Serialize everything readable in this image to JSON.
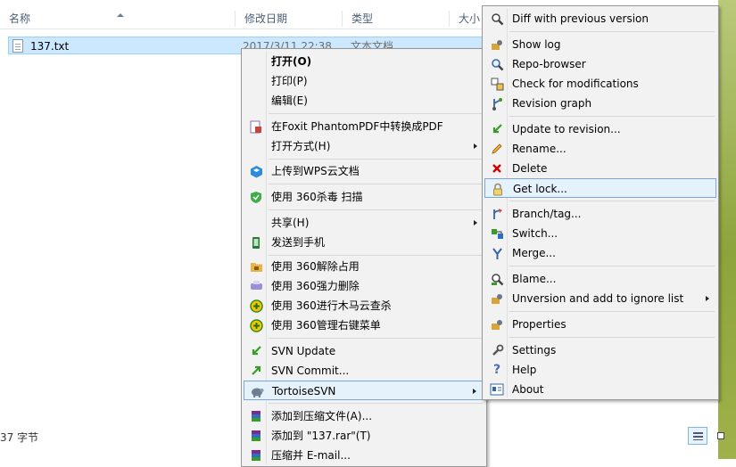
{
  "columns": {
    "name": "名称",
    "modified": "修改日期",
    "type": "类型",
    "size": "大小"
  },
  "file": {
    "name": "137.txt",
    "modified": "2017/3/11 22:38",
    "type": "文本文档"
  },
  "status": {
    "text": "37 字节"
  },
  "context_menu": {
    "open": "打开(O)",
    "print": "打印(P)",
    "edit": "编辑(E)",
    "foxit": "在Foxit PhantomPDF中转换成PDF",
    "open_with": "打开方式(H)",
    "wps_upload": "上传到WPS云文档",
    "scan_360": "使用 360杀毒 扫描",
    "share": "共享(H)",
    "send_phone": "发送到手机",
    "unlock_360": "使用 360解除占用",
    "force_delete_360": "使用 360强力删除",
    "trojan_360": "使用 360进行木马云查杀",
    "manage_360": "使用 360管理右键菜单",
    "svn_update": "SVN Update",
    "svn_commit": "SVN Commit...",
    "tortoise": "TortoiseSVN",
    "add_archive": "添加到压缩文件(A)...",
    "add_rar": "添加到 \"137.rar\"(T)",
    "compress_email": "压缩并 E-mail..."
  },
  "svn_menu": {
    "diff": "Diff with previous version",
    "show_log": "Show log",
    "repo_browser": "Repo-browser",
    "check_mod": "Check for modifications",
    "revision_graph": "Revision graph",
    "update_rev": "Update to revision...",
    "rename": "Rename...",
    "delete": "Delete",
    "get_lock": "Get lock...",
    "branch_tag": "Branch/tag...",
    "switch": "Switch...",
    "merge": "Merge...",
    "blame": "Blame...",
    "unversion": "Unversion and add to ignore list",
    "properties": "Properties",
    "settings": "Settings",
    "help": "Help",
    "about": "About"
  },
  "icons": {
    "accent": "#0078d7",
    "svn_green": "#3a9a2a",
    "delete_red": "#d40000"
  }
}
